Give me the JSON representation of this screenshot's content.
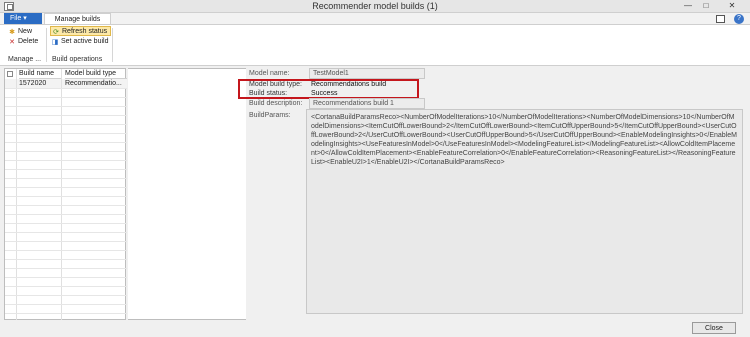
{
  "window": {
    "title": "Recommender model builds (1)",
    "controls": {
      "minimize": "—",
      "maximize": "□",
      "close": "✕"
    }
  },
  "ribbon": {
    "file_tab": "File",
    "active_tab": "Manage builds",
    "buttons": {
      "new": "New",
      "delete": "Delete",
      "refresh_status": "Refresh status",
      "set_active_build": "Set active build"
    },
    "groups": {
      "manage": "Manage ...",
      "build_operations": "Build operations"
    }
  },
  "grid": {
    "columns": [
      "Build name",
      "Model build type"
    ],
    "rows": [
      {
        "build_name": "1572020",
        "model_build_type": "Recommendatio..."
      }
    ]
  },
  "details": {
    "model_name_label": "Model name:",
    "model_name_value": "TestModel1",
    "model_build_type_label": "Model build type:",
    "model_build_type_value": "Recommendations build",
    "build_status_label": "Build status:",
    "build_status_value": "Success",
    "build_description_label": "Build description:",
    "build_description_value": "Recommendations build 1",
    "build_params_label": "BuildParams:",
    "build_params_value": "<CortanaBuildParamsReco><NumberOfModelIterations>10</NumberOfModelIterations><NumberOfModelDimensions>10</NumberOfModelDimensions><ItemCutOffLowerBound>2</ItemCutOffLowerBound><ItemCutOffUpperBound>5</ItemCutOffUpperBound><UserCutOffLowerBound>2</UserCutOffLowerBound><UserCutOffUpperBound>5</UserCutOffUpperBound><EnableModelingInsights>0</EnableModelingInsights><UseFeaturesInModel>0</UseFeaturesInModel><ModelingFeatureList></ModelingFeatureList><AllowColdItemPlacement>0</AllowColdItemPlacement><EnableFeatureCorrelation>0</EnableFeatureCorrelation><ReasoningFeatureList></ReasoningFeatureList><EnableU2I>1</EnableU2I></CortanaBuildParamsReco>"
  },
  "footer": {
    "close_button": "Close"
  },
  "colors": {
    "file_tab": "#2b6cc4",
    "highlight_box": "#c4161c",
    "refresh_highlight": "#fde9a8"
  }
}
